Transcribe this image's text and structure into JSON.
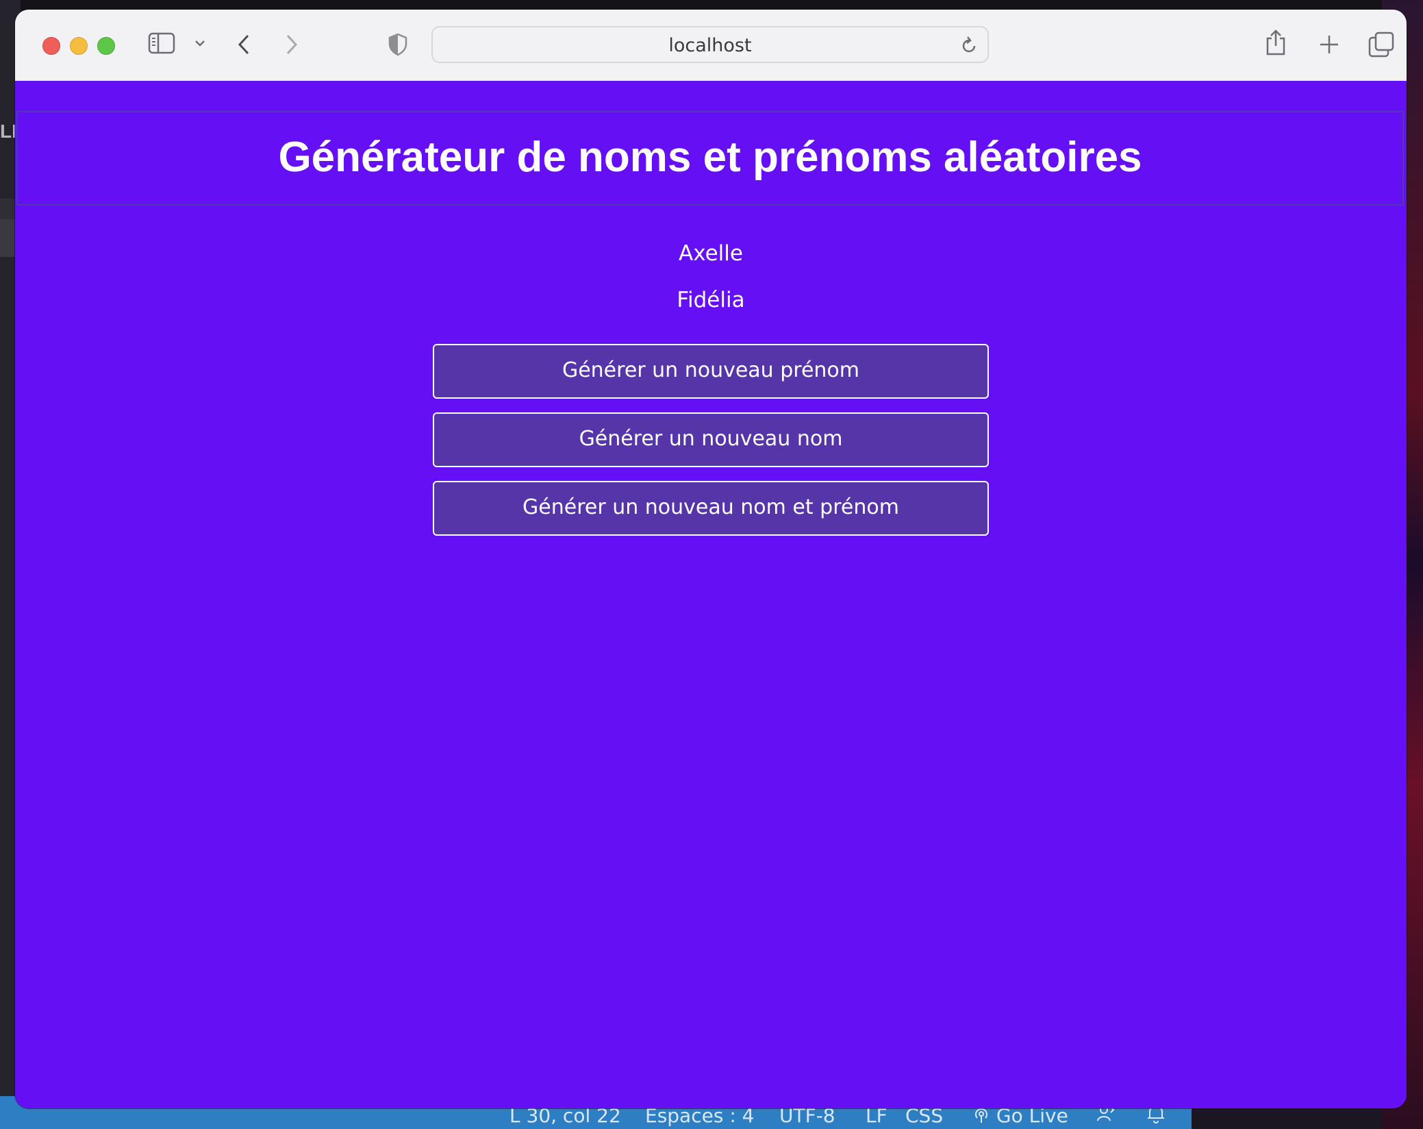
{
  "browser": {
    "url": "localhost"
  },
  "page": {
    "title": "Générateur de noms et prénoms aléatoires",
    "first_name": "Axelle",
    "last_name": "Fidélia",
    "buttons": {
      "new_first_name": "Générer un nouveau prénom",
      "new_last_name": "Générer un nouveau nom",
      "new_full_name": "Générer un nouveau nom et prénom"
    }
  },
  "statusbar": {
    "position": "L 30, col 22",
    "indent": "Espaces : 4",
    "encoding": "UTF-8",
    "eol": "LF",
    "language": "CSS",
    "go_live": "Go Live"
  },
  "background_fragment": "LE",
  "colors": {
    "page_bg": "#650ff5",
    "button_bg": "#5535a8",
    "statusbar_bg": "#2e7ec4"
  }
}
